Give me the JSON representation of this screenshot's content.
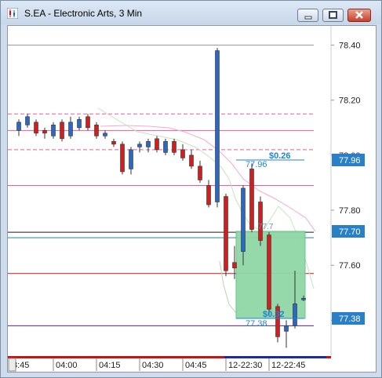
{
  "window": {
    "title": "S.EA - Electronic Arts, 3 Min"
  },
  "colors": {
    "up": "#2c67c0",
    "down": "#cf1f1f",
    "price_axis_tag": "#2a80c6",
    "zone_fill": "#90d7a6",
    "zone_border": "#63c083",
    "annotation": "#1f83d4"
  },
  "axis": {
    "y_ticks": [
      "78.40",
      "78.20",
      "78.00",
      "77.80",
      "77.60",
      "77.40"
    ],
    "x_ticks": [
      "3:45",
      "04:00",
      "04:15",
      "04:30",
      "04:45",
      "12-22:30",
      "12-22:45"
    ]
  },
  "price_tags": [
    "77.96",
    "77.70",
    "77.38"
  ],
  "annotations": {
    "top_delta": "$0.26",
    "top_price": "77.96",
    "mid_price": "77.7",
    "bottom_delta": "$0.32",
    "bottom_price": "77.38"
  },
  "chart_data": {
    "type": "candlestick",
    "ylim": [
      77.27,
      78.47
    ],
    "candles": [
      {
        "o": 78.09,
        "h": 78.13,
        "l": 78.07,
        "c": 78.12
      },
      {
        "o": 78.11,
        "h": 78.15,
        "l": 78.1,
        "c": 78.14
      },
      {
        "o": 78.12,
        "h": 78.13,
        "l": 78.07,
        "c": 78.08
      },
      {
        "o": 78.09,
        "h": 78.1,
        "l": 78.06,
        "c": 78.08
      },
      {
        "o": 78.07,
        "h": 78.12,
        "l": 78.06,
        "c": 78.11
      },
      {
        "o": 78.12,
        "h": 78.13,
        "l": 78.05,
        "c": 78.06
      },
      {
        "o": 78.07,
        "h": 78.14,
        "l": 78.06,
        "c": 78.12
      },
      {
        "o": 78.1,
        "h": 78.14,
        "l": 78.09,
        "c": 78.13
      },
      {
        "o": 78.14,
        "h": 78.15,
        "l": 78.09,
        "c": 78.1
      },
      {
        "o": 78.11,
        "h": 78.12,
        "l": 78.06,
        "c": 78.07
      },
      {
        "o": 78.07,
        "h": 78.09,
        "l": 78.06,
        "c": 78.08
      },
      {
        "o": 78.05,
        "h": 78.06,
        "l": 78.03,
        "c": 78.04
      },
      {
        "o": 78.04,
        "h": 78.05,
        "l": 77.93,
        "c": 77.94
      },
      {
        "o": 77.95,
        "h": 78.03,
        "l": 77.93,
        "c": 78.02
      },
      {
        "o": 78.03,
        "h": 78.05,
        "l": 78.01,
        "c": 78.04
      },
      {
        "o": 78.03,
        "h": 78.06,
        "l": 78.01,
        "c": 78.05
      },
      {
        "o": 78.06,
        "h": 78.07,
        "l": 78.01,
        "c": 78.02
      },
      {
        "o": 78.01,
        "h": 78.06,
        "l": 78.0,
        "c": 78.05
      },
      {
        "o": 78.05,
        "h": 78.06,
        "l": 78.0,
        "c": 78.01
      },
      {
        "o": 78.02,
        "h": 78.04,
        "l": 77.98,
        "c": 77.99
      },
      {
        "o": 78.0,
        "h": 78.02,
        "l": 77.95,
        "c": 77.96
      },
      {
        "o": 77.96,
        "h": 77.98,
        "l": 77.9,
        "c": 77.91
      },
      {
        "o": 77.89,
        "h": 77.91,
        "l": 77.81,
        "c": 77.82
      },
      {
        "o": 77.83,
        "h": 78.39,
        "l": 77.81,
        "c": 78.38
      },
      {
        "o": 77.85,
        "h": 77.86,
        "l": 77.56,
        "c": 77.58
      },
      {
        "o": 77.61,
        "h": 77.67,
        "l": 77.55,
        "c": 77.59
      },
      {
        "o": 77.65,
        "h": 77.89,
        "l": 77.6,
        "c": 77.88
      },
      {
        "o": 77.95,
        "h": 77.97,
        "l": 77.72,
        "c": 77.73
      },
      {
        "o": 77.83,
        "h": 77.85,
        "l": 77.67,
        "c": 77.69
      },
      {
        "o": 77.71,
        "h": 77.72,
        "l": 77.42,
        "c": 77.44
      },
      {
        "o": 77.45,
        "h": 77.46,
        "l": 77.32,
        "c": 77.34
      },
      {
        "o": 77.36,
        "h": 77.4,
        "l": 77.3,
        "c": 77.38
      },
      {
        "o": 77.38,
        "h": 77.58,
        "l": 77.37,
        "c": 77.46
      },
      {
        "o": 77.48,
        "h": 77.49,
        "l": 77.47,
        "c": 77.48
      }
    ],
    "hlines": [
      {
        "price": 78.4,
        "color": "#9a9a9a"
      },
      {
        "price": 78.15,
        "color": "#e0609a",
        "dash": true
      },
      {
        "price": 78.09,
        "color": "#e0609a",
        "dash": false
      },
      {
        "price": 78.02,
        "color": "#e0609a",
        "dash": true
      },
      {
        "price": 77.89,
        "color": "#e0609a",
        "dash": false
      },
      {
        "price": 77.72,
        "color": "#1a1a1a",
        "dash": false
      },
      {
        "price": 77.7,
        "color": "#1e8a92",
        "dash": false
      },
      {
        "price": 77.57,
        "color": "#c01818",
        "dash": false
      },
      {
        "price": 77.38,
        "color": "#5a2080",
        "dash": false
      }
    ]
  }
}
